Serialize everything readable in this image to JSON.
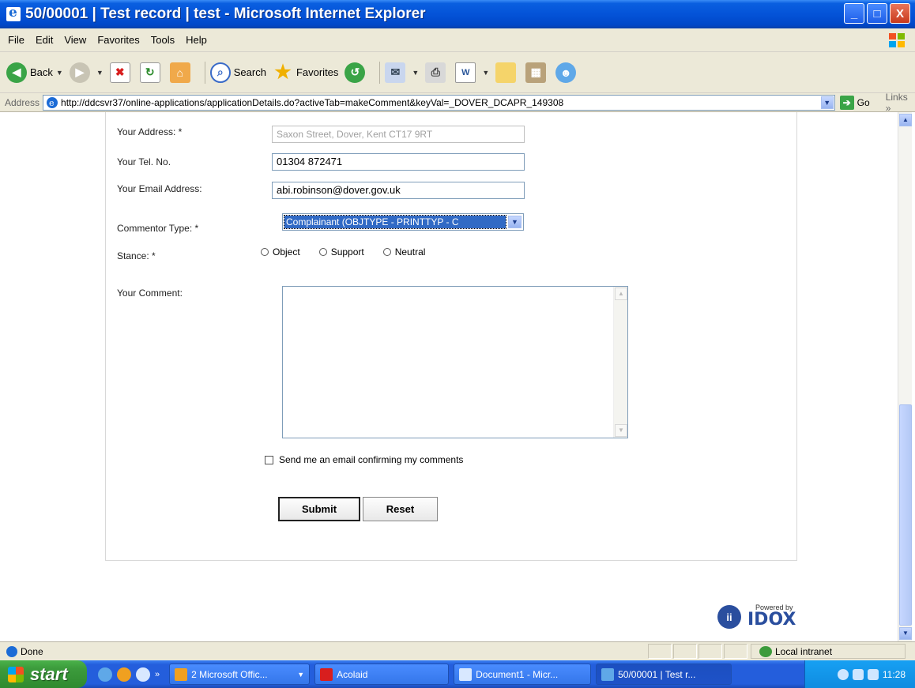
{
  "window": {
    "title": "50/00001 | Test record | test - Microsoft Internet Explorer",
    "controls": [
      "_",
      "□",
      "X"
    ]
  },
  "menubar": {
    "items": [
      "File",
      "Edit",
      "View",
      "Favorites",
      "Tools",
      "Help"
    ]
  },
  "toolbar": {
    "back_label": "Back",
    "search_label": "Search",
    "favorites_label": "Favorites"
  },
  "addressbar": {
    "label": "Address",
    "url": "http://ddcsvr37/online-applications/applicationDetails.do?activeTab=makeComment&keyVal=_DOVER_DCAPR_149308",
    "go_label": "Go",
    "links_label": "Links »"
  },
  "form": {
    "address_label": "Your Address: *",
    "address_value": "Saxon Street, Dover, Kent CT17 9RT",
    "tel_label": "Your Tel. No.",
    "tel_value": "01304 872471",
    "email_label": "Your Email Address:",
    "email_value": "abi.robinson@dover.gov.uk",
    "commentor_label": "Commentor Type: *",
    "commentor_value": "Complainant (OBJTYPE - PRINTTYP - C",
    "stance_label": "Stance: *",
    "stance_options": [
      "Object",
      "Support",
      "Neutral"
    ],
    "comment_label": "Your Comment:",
    "confirm_label": "Send me an email confirming my comments",
    "submit_label": "Submit",
    "reset_label": "Reset"
  },
  "branding": {
    "powered_by": "Powered by",
    "name": "IDOX"
  },
  "statusbar": {
    "status": "Done",
    "zone": "Local intranet"
  },
  "taskbar": {
    "start_label": "start",
    "tasks": [
      "2 Microsoft Offic...",
      "Acolaid",
      "Document1 - Micr...",
      "50/00001 | Test r..."
    ],
    "clock": "11:28"
  }
}
